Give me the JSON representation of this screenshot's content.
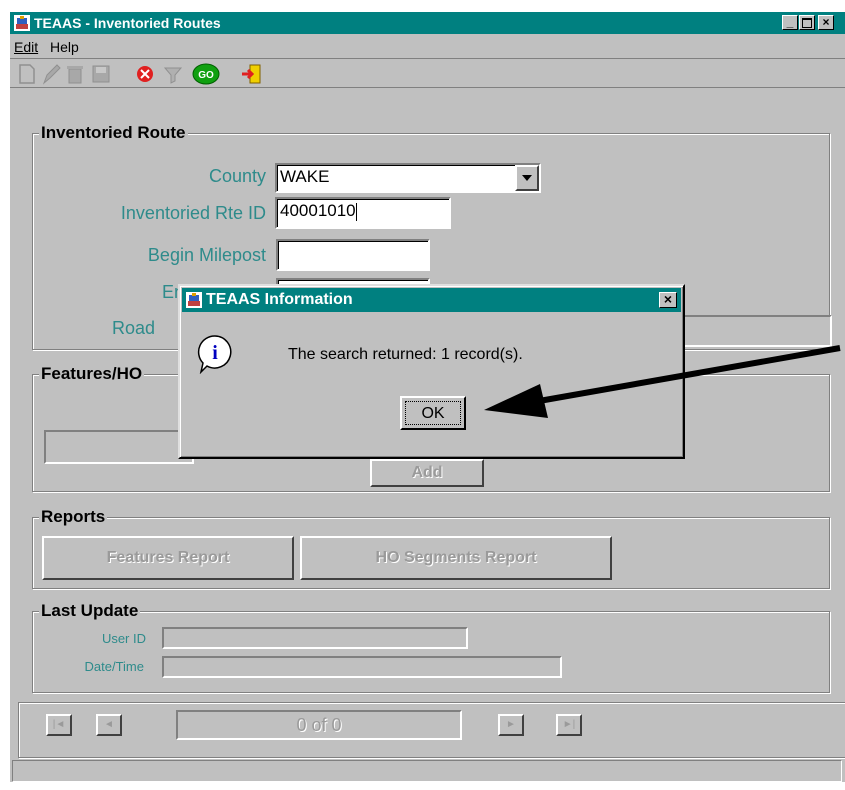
{
  "window": {
    "title": "TEAAS - Inventoried Routes"
  },
  "menu": {
    "edit": "Edit",
    "help": "Help"
  },
  "toolbar": {
    "icons": [
      "new-icon",
      "edit-icon",
      "delete-icon",
      "save-icon",
      "cancel-icon",
      "clear-icon",
      "go-icon",
      "exit-icon"
    ],
    "go_label": "GO"
  },
  "route": {
    "group_title": "Inventoried Route",
    "county_label": "County",
    "county_value": "WAKE",
    "rte_id_label": "Inventoried Rte ID",
    "rte_id_value": "40001010",
    "begin_label": "Begin Milepost",
    "end_label": "End Milepost",
    "road_label": "Road"
  },
  "features": {
    "group_title": "Features/HO",
    "add_label": "Add"
  },
  "reports": {
    "group_title": "Reports",
    "features_report": "Features Report",
    "ho_segments_report": "HO Segments Report"
  },
  "last_update": {
    "group_title": "Last Update",
    "user_id_label": "User ID",
    "datetime_label": "Date/Time"
  },
  "nav": {
    "record_counter": "0 of 0"
  },
  "dialog": {
    "title": "TEAAS Information",
    "message": "The search returned: 1 record(s).",
    "ok_label": "OK",
    "close": "×"
  },
  "colors": {
    "titlebar": "#008080",
    "label_teal": "#2e8b8b",
    "face": "#c0c0c0"
  }
}
